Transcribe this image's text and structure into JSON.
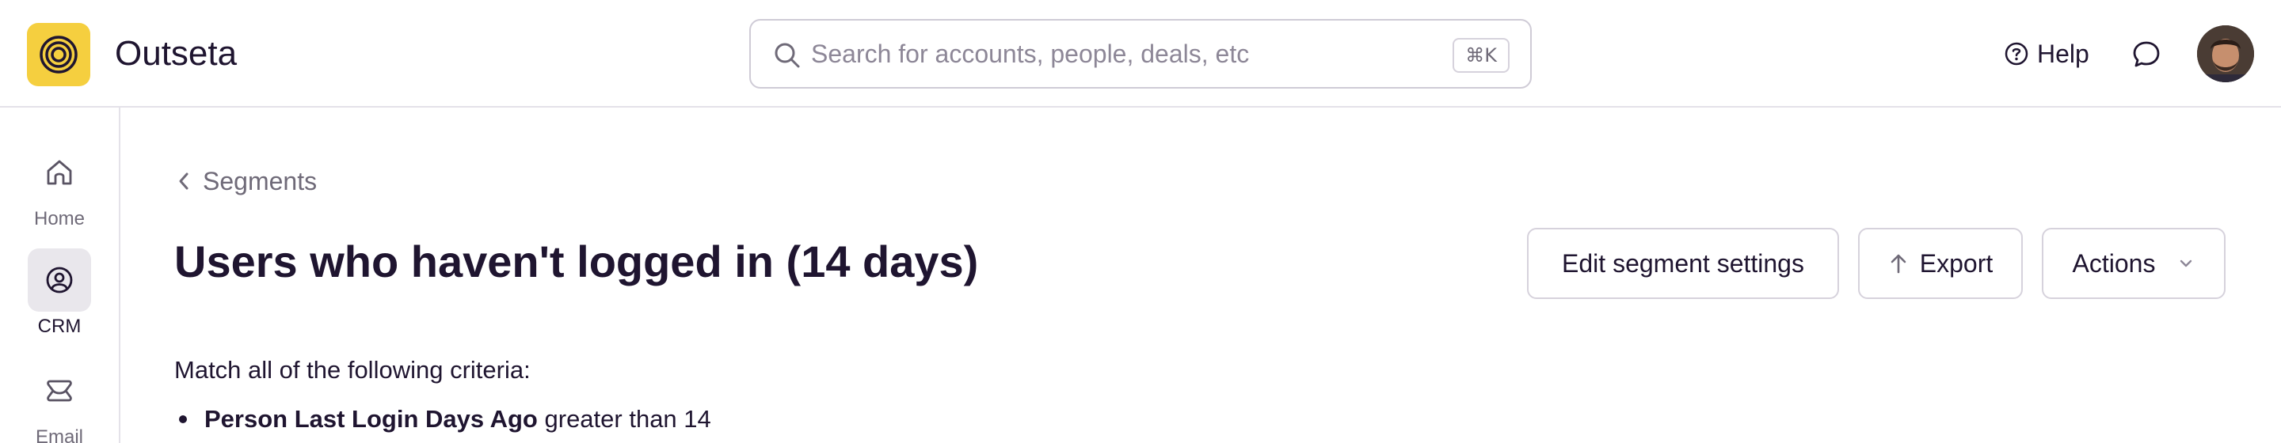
{
  "app": {
    "name": "Outseta",
    "accent": "#f5cf3f"
  },
  "header": {
    "search": {
      "placeholder": "Search for accounts, people, deals, etc",
      "value": "",
      "shortcut": "⌘K",
      "icon": "search-icon"
    },
    "help_label": "Help",
    "help_icon": "help-circle-icon",
    "chat_icon": "chat-bubble-icon",
    "avatar": "user-avatar"
  },
  "sidebar": {
    "items": [
      {
        "label": "Home",
        "icon": "home-icon",
        "active": false
      },
      {
        "label": "CRM",
        "icon": "crm-person-icon",
        "active": true
      },
      {
        "label": "Email",
        "icon": "email-icon",
        "active": false
      }
    ]
  },
  "main": {
    "breadcrumb": {
      "label": "Segments",
      "icon": "chevron-left-icon"
    },
    "title": "Users who haven't logged in (14 days)",
    "buttons": {
      "edit_label": "Edit segment settings",
      "export_label": "Export",
      "export_icon": "arrow-up-icon",
      "actions_label": "Actions",
      "actions_icon": "chevron-down-icon"
    },
    "criteria": {
      "heading": "Match all of the following criteria:",
      "items": [
        {
          "field": "Person Last Login Days Ago",
          "operator": "greater than",
          "value": "14"
        }
      ]
    }
  }
}
